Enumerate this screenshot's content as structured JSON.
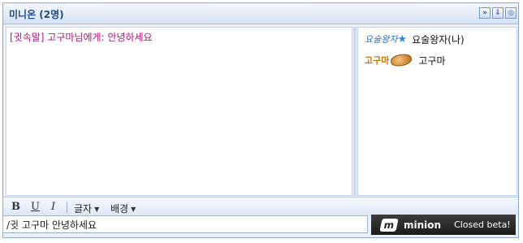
{
  "window": {
    "title": "미니온 (2명)",
    "buttons": [
      {
        "icon": "collapse-icon",
        "glyph": "»"
      },
      {
        "icon": "pin-icon",
        "glyph": "⇩"
      },
      {
        "icon": "settings-icon",
        "glyph": "◎"
      }
    ]
  },
  "chat": {
    "messages": [
      {
        "text": "[귓속말] 고구마님에게: 안녕하세요",
        "color": "#b0177a"
      }
    ]
  },
  "users": [
    {
      "badge": "요술왕자",
      "badge_icon": "star-icon",
      "name": "요술왕자(나)"
    },
    {
      "badge": "고구마",
      "badge_icon": "sweet-potato-icon",
      "name": "고구마"
    }
  ],
  "toolbar": {
    "bold": "B",
    "underline": "U",
    "italic": "I",
    "font_menu": "글자",
    "background_menu": "배경"
  },
  "input": {
    "value": "/귓 고구마 안녕하세요"
  },
  "brand": {
    "logo_letter": "m",
    "name": "minion",
    "tagline": "Closed beta!"
  },
  "colors": {
    "accent": "#234a85",
    "whisper": "#b0177a",
    "frame": "#8ea7cf"
  }
}
